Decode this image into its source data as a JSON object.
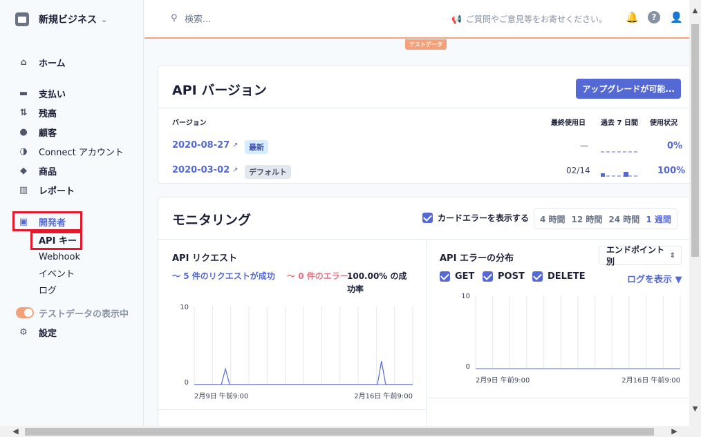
{
  "sidebar": {
    "business_name": "新規ビジネス",
    "home": "ホーム",
    "items": [
      {
        "label": "支払い",
        "icon": "payments-icon"
      },
      {
        "label": "残高",
        "icon": "balance-icon"
      },
      {
        "label": "顧客",
        "icon": "customers-icon"
      },
      {
        "label": "Connect アカウント",
        "icon": "connect-icon"
      },
      {
        "label": "商品",
        "icon": "products-icon"
      },
      {
        "label": "レポート",
        "icon": "reports-icon"
      }
    ],
    "developers": "開発者",
    "dev_items": [
      "API キー",
      "Webhook",
      "イベント",
      "ログ"
    ],
    "test_data_toggle": "テストデータの表示中",
    "settings": "設定"
  },
  "topbar": {
    "search_placeholder": "検索...",
    "feedback": "ご質問やご意見等をお寄せください。",
    "test_badge": "テストデータ"
  },
  "api_versions": {
    "title": "API バージョン",
    "upgrade_button": "アップグレードが可能...",
    "headers": {
      "version": "バージョン",
      "last_used": "最終使用日",
      "last7": "過去 7 日間",
      "usage": "使用状況"
    },
    "rows": [
      {
        "version": "2020-08-27",
        "badge": "最新",
        "last_used": "—",
        "usage": "0%"
      },
      {
        "version": "2020-03-02",
        "badge": "デフォルト",
        "last_used": "02/14",
        "usage": "100%"
      }
    ]
  },
  "monitoring": {
    "title": "モニタリング",
    "show_card_errors": "カードエラーを表示する",
    "ranges": [
      "4 時間",
      "12 時間",
      "24 時間",
      "1 週間"
    ],
    "active_range": "1 週間",
    "requests": {
      "title": "API リクエスト",
      "success": "5 件のリクエストが成功",
      "errors": "0 件のエラー",
      "rate_line1": "100.00% の成",
      "rate_line2": "功率"
    },
    "errors": {
      "title": "API エラーの分布",
      "select": "エンドポイント別",
      "methods": [
        "GET",
        "POST",
        "DELETE"
      ],
      "view_logs": "ログを表示"
    }
  },
  "chart_data": [
    {
      "type": "line",
      "title": "API リクエスト",
      "x": [
        "2月9日 午前9:00",
        "2月10日",
        "2月11日",
        "2月12日",
        "2月13日",
        "2月14日",
        "2月15日",
        "2月16日 午前9:00"
      ],
      "x_tick_labels": [
        "2月9日 午前9:00",
        "2月16日 午前9:00"
      ],
      "ylim": [
        0,
        10
      ],
      "y_tick_labels": [
        "10",
        "0"
      ],
      "series": [
        {
          "name": "5 件のリクエストが成功",
          "color": "#5469d4",
          "peaks": [
            {
              "x": "2月10日",
              "value": 2
            },
            {
              "x": "2月15日",
              "value": 3
            }
          ]
        },
        {
          "name": "0 件のエラー",
          "color": "#e56f7e",
          "peaks": []
        }
      ],
      "grid": true
    },
    {
      "type": "bar",
      "title": "API エラーの分布",
      "x_tick_labels": [
        "2月9日 午前9:00",
        "2月16日 午前9:00"
      ],
      "ylim": [
        0,
        10
      ],
      "y_tick_labels": [
        "10",
        "0"
      ],
      "series": [],
      "grid": true
    }
  ],
  "colors": {
    "accent": "#5469d4",
    "test_mode": "#f5a079",
    "error": "#e56f7e"
  }
}
